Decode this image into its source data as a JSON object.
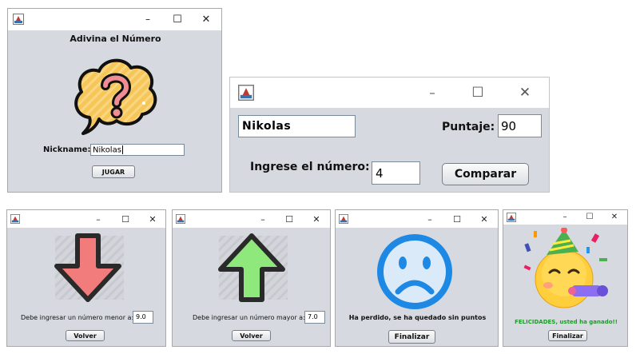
{
  "start_window": {
    "title": "Adivina el Número",
    "nickname_label": "Nickname:",
    "nickname_value": "Nikolas",
    "play_button": "JUGAR",
    "icon": "question-thought-bubble-icon"
  },
  "game_window": {
    "name_value": "Nikolas",
    "score_label": "Puntaje:",
    "score_value": "90",
    "enter_label": "Ingrese el número:",
    "number_value": "4",
    "compare_button": "Comparar"
  },
  "lower_window": {
    "message": "Debe ingresar un número menor a:",
    "value": "9.0",
    "back_button": "Volver",
    "icon": "arrow-down-icon",
    "color": "#f27b7b"
  },
  "higher_window": {
    "message": "Debe ingresar un número mayor a:",
    "value": "7.0",
    "back_button": "Volver",
    "icon": "arrow-up-icon",
    "color": "#8ee87c"
  },
  "lose_window": {
    "message": "Ha perdido, se ha quedado sin puntos",
    "finish_button": "Finalizar",
    "icon": "sad-face-icon",
    "color": "#1e88e5"
  },
  "win_window": {
    "message": "FELICIDADES, usted ha ganado!!",
    "finish_button": "Finalizar",
    "icon": "party-face-icon",
    "message_color": "#1f9b2c"
  },
  "window_controls": {
    "minimize": "–",
    "maximize": "☐",
    "close": "✕"
  }
}
